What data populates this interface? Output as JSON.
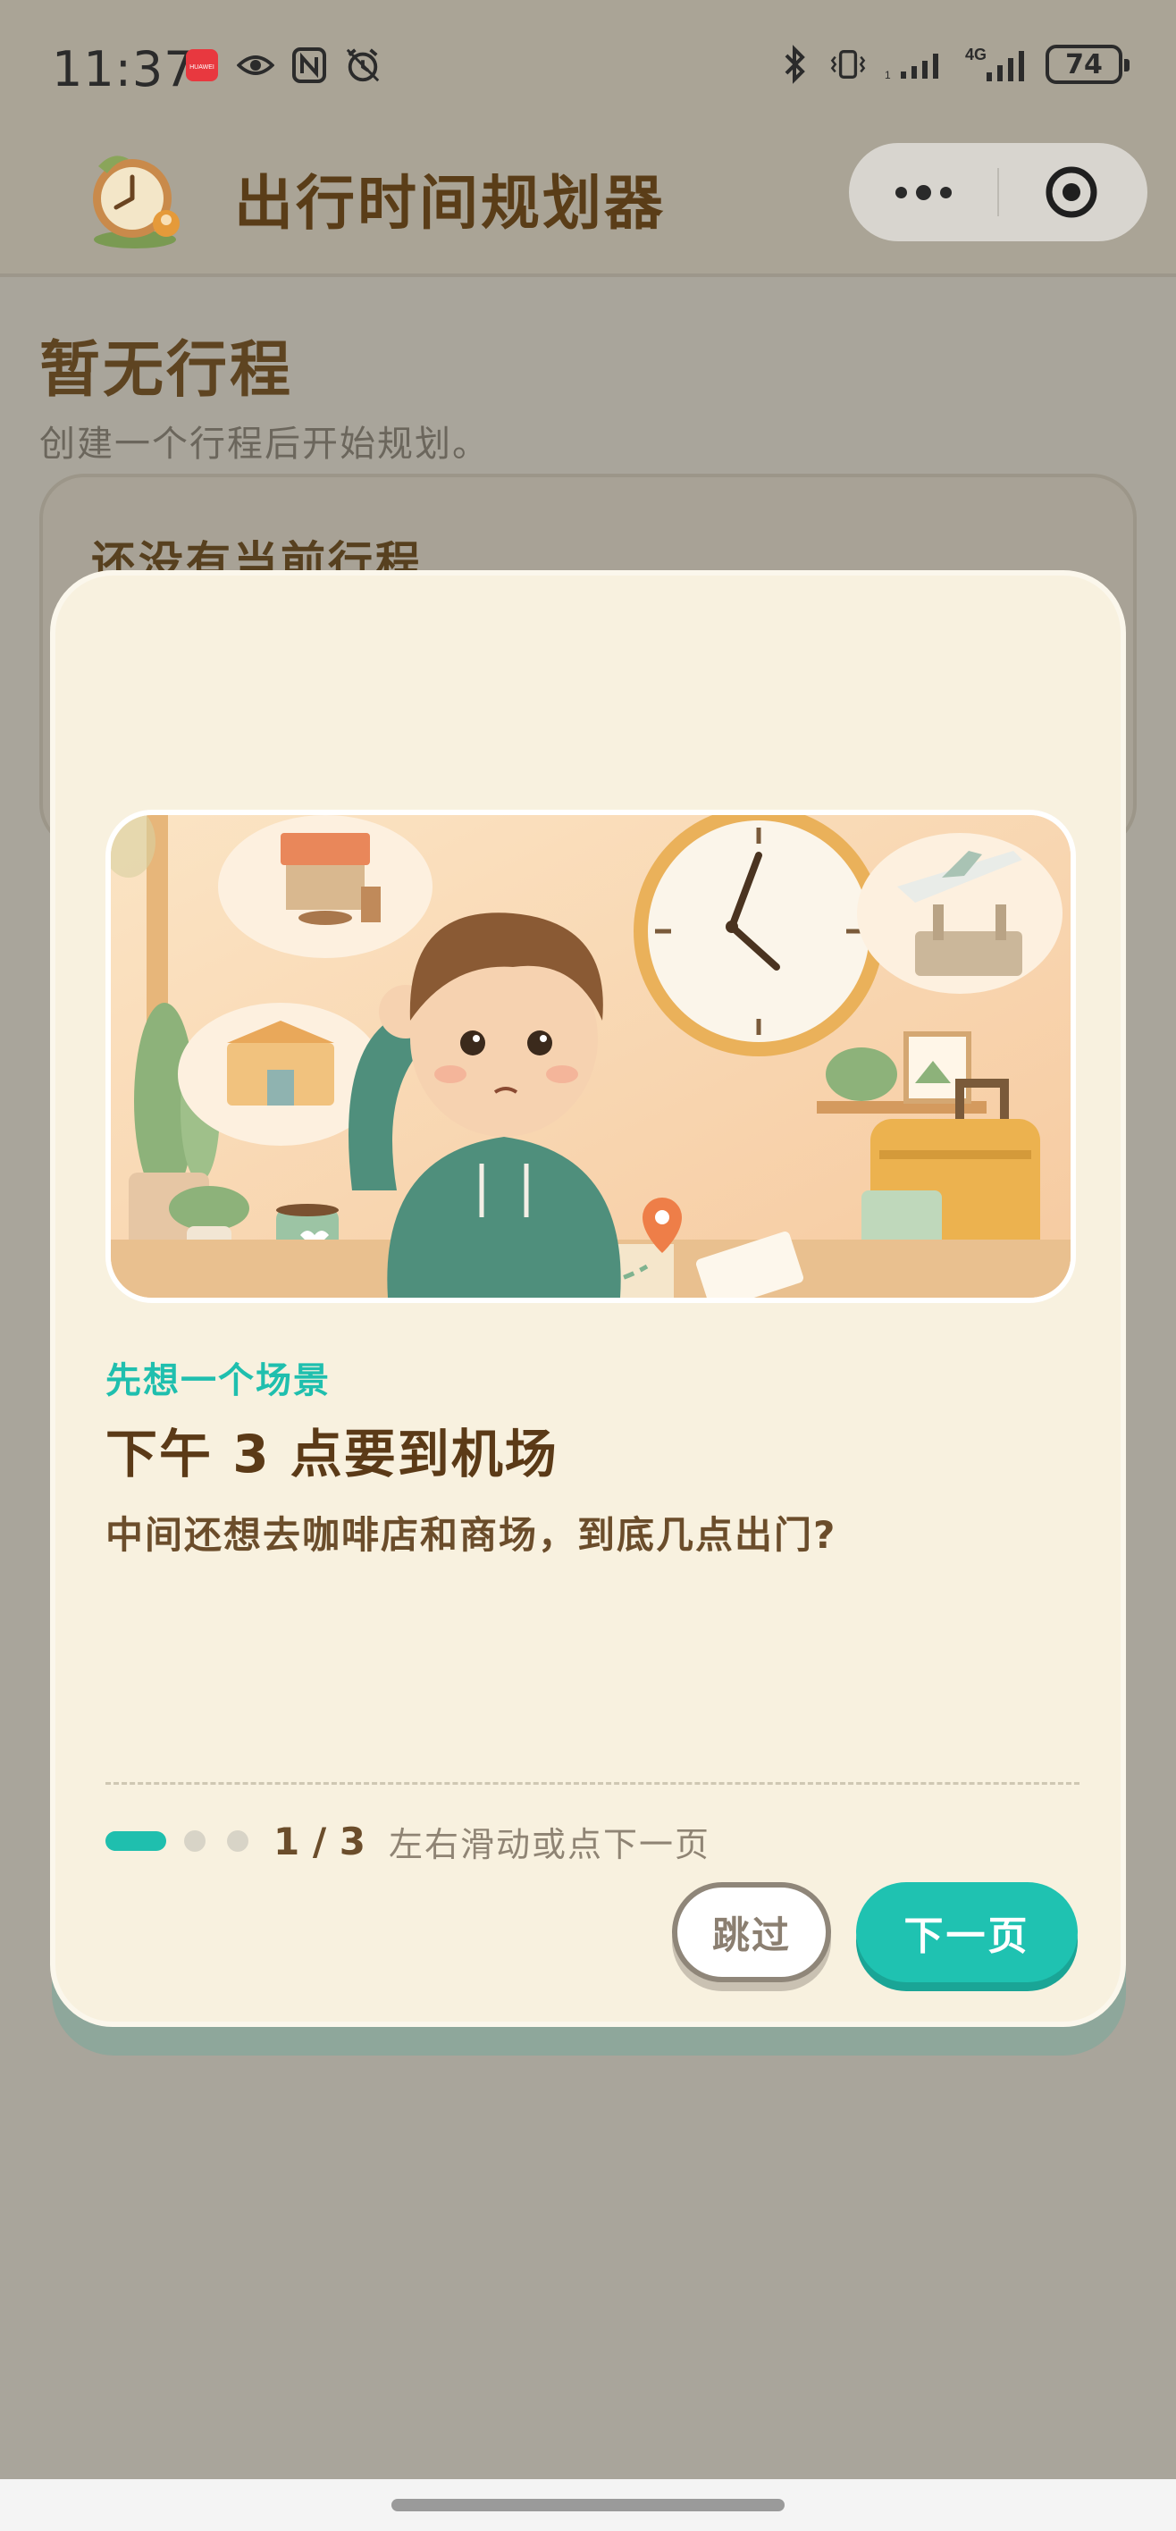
{
  "status_bar": {
    "time": "11:37",
    "battery": "74",
    "left_icons": [
      "huawei-store-icon",
      "eye-icon",
      "nfc-icon",
      "alarm-icon"
    ],
    "right_icons": [
      "bluetooth-icon",
      "vibrate-icon",
      "signal-icon",
      "4g-signal-icon",
      "battery-icon"
    ]
  },
  "header": {
    "title": "出行时间规划器",
    "logo": "clock-logo-icon",
    "capsule": {
      "more": "more-icon",
      "close": "target-icon"
    }
  },
  "background": {
    "title": "暂无行程",
    "subtitle": "创建一个行程后开始规划。",
    "card_title": "还没有当前行程"
  },
  "modal": {
    "illustration": "planning-boy-illustration",
    "kicker": "先想一个场景",
    "title": "下午 3 点要到机场",
    "description": "中间还想去咖啡店和商场，到底几点出门?",
    "pager": {
      "current": 1,
      "total": 3,
      "label": "1 / 3",
      "hint": "左右滑动或点下一页"
    },
    "skip_label": "跳过",
    "next_label": "下一页"
  },
  "colors": {
    "accent": "#1fc2b1",
    "title_brown": "#5b3a17",
    "modal_bg": "#f8f1df",
    "overlay": "#a9a59b"
  }
}
